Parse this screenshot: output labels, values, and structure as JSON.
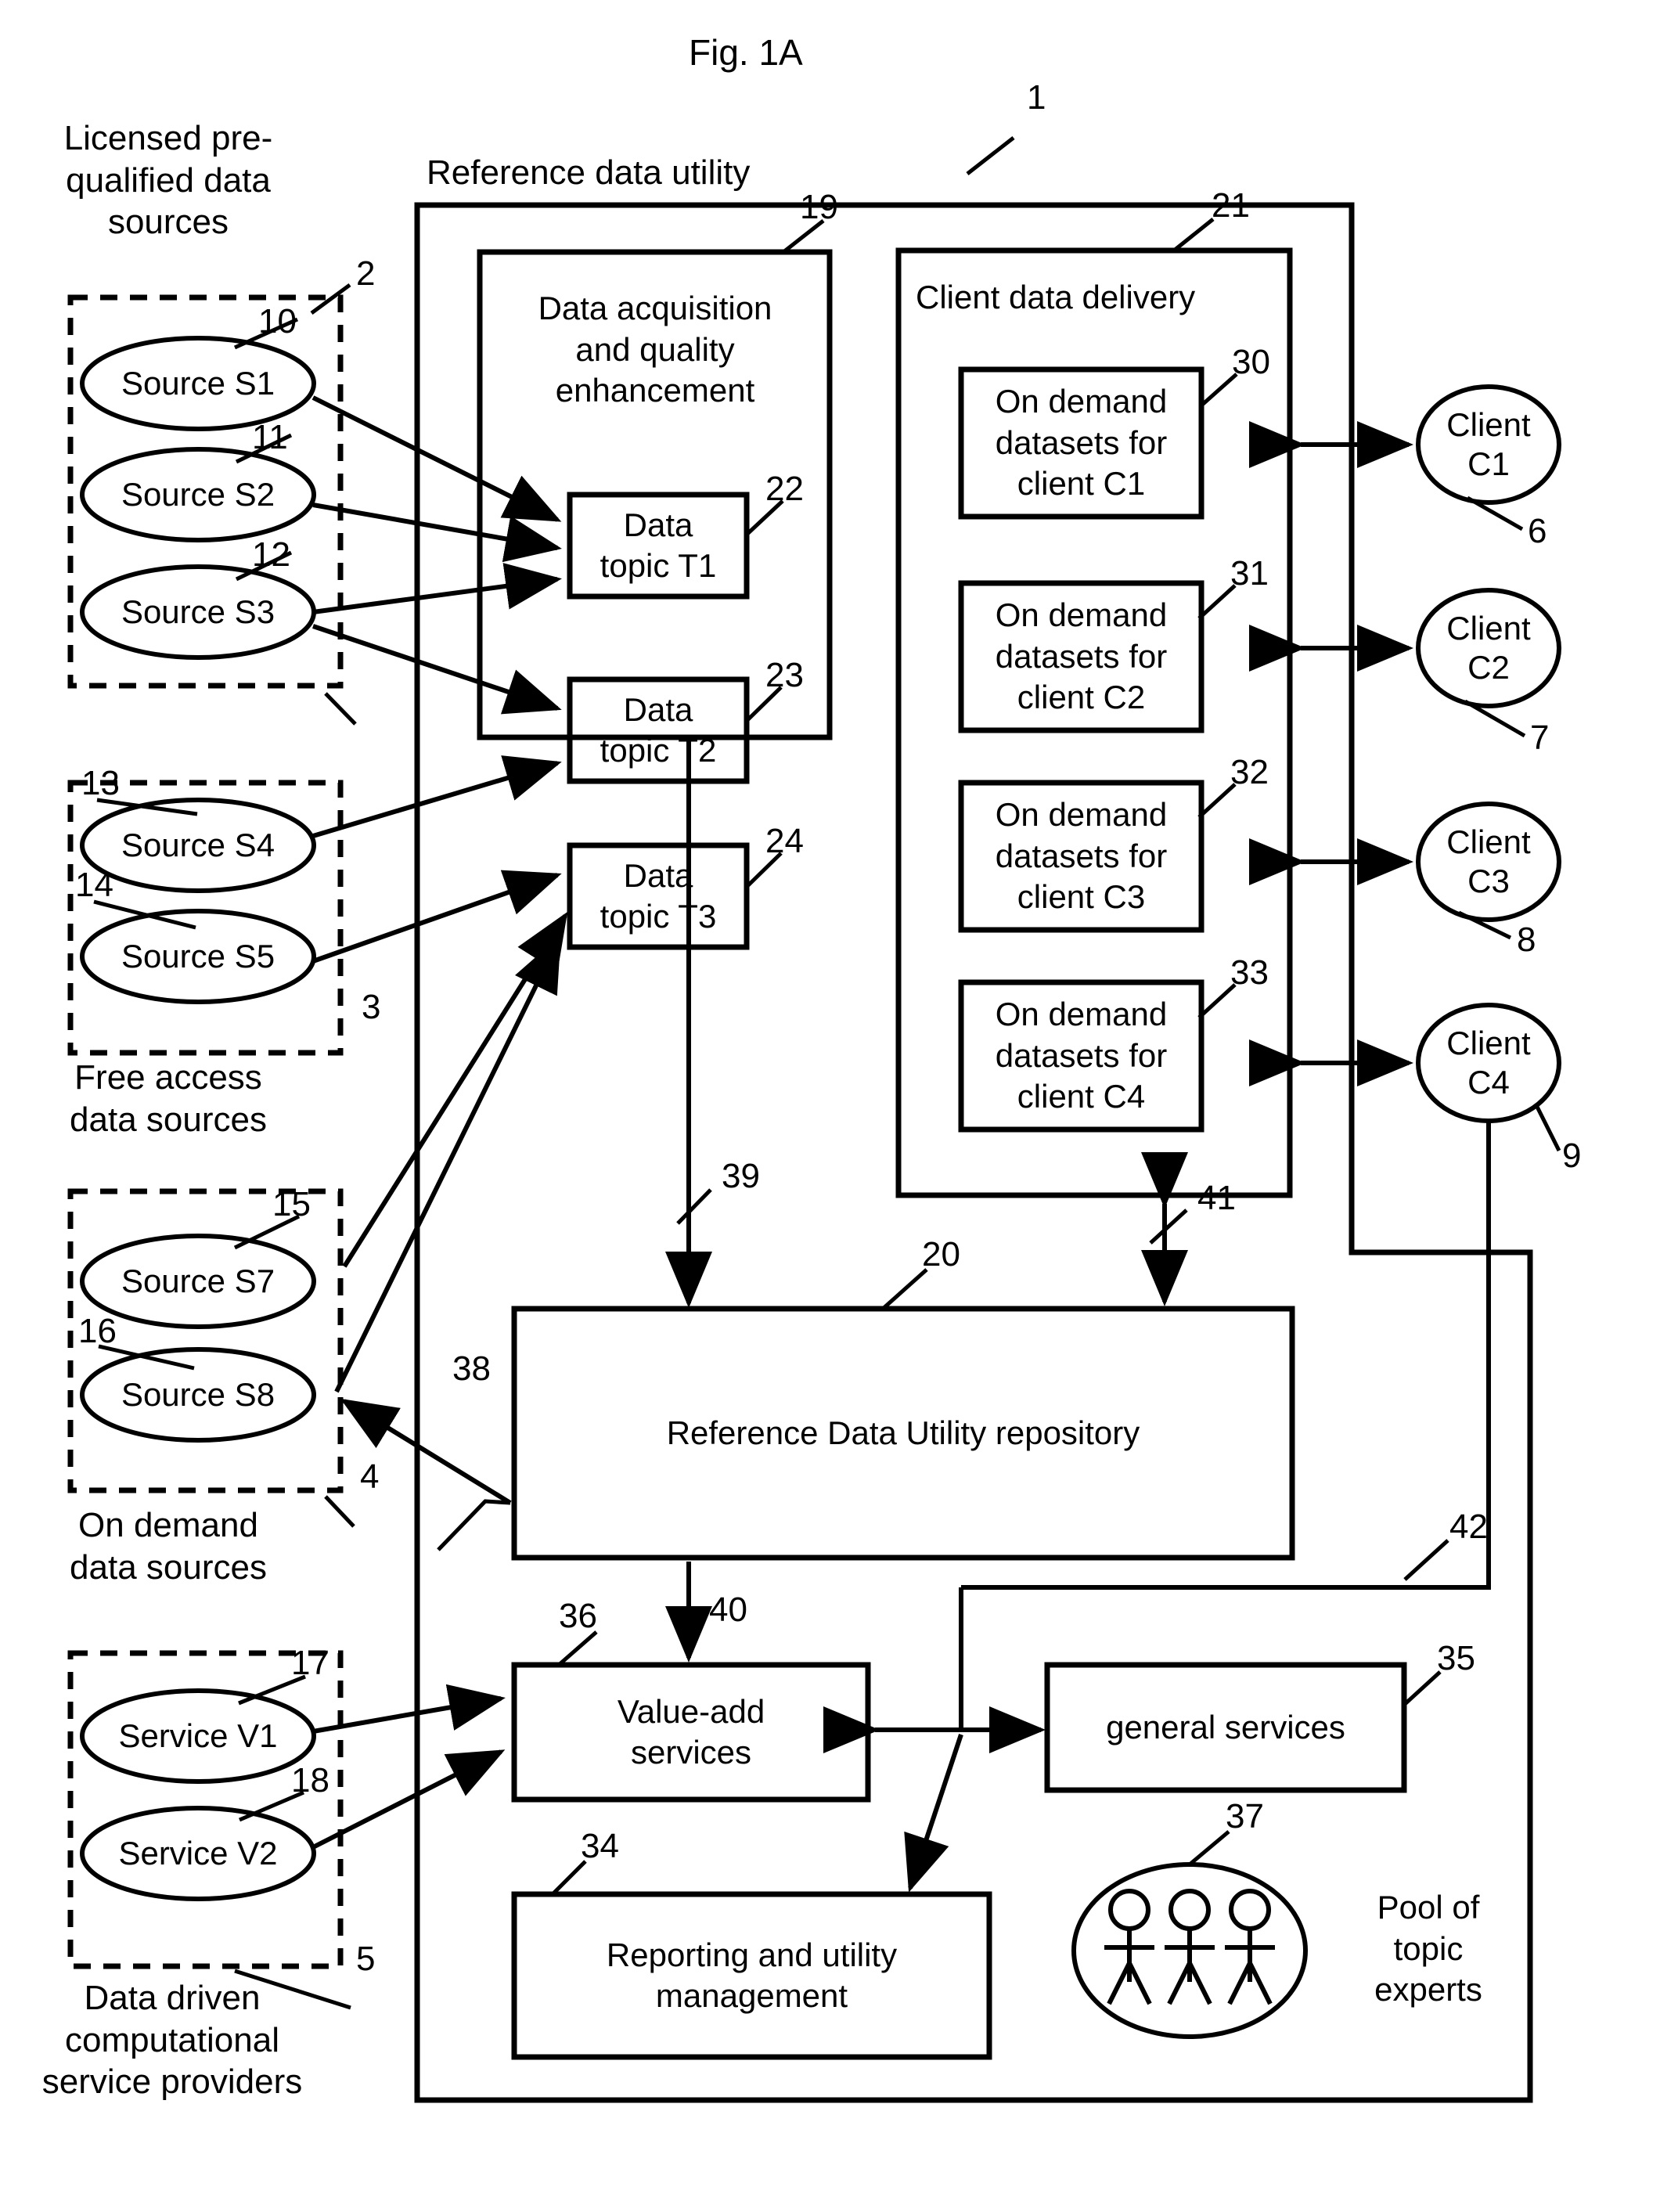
{
  "figure": {
    "title": "Fig. 1A"
  },
  "diagram": {
    "main_title": "Reference data utility",
    "main_ref": "1",
    "group_captions": {
      "licensed": "Licensed pre-\nqualified  data\nsources",
      "free": "Free access\ndata sources",
      "on_demand": "On demand\ndata sources",
      "providers": "Data driven\ncomputational\nservice providers"
    },
    "group_refs": {
      "licensed": "2",
      "free": "3",
      "on_demand": "4",
      "providers": "5"
    },
    "sources": [
      {
        "label": "Source S1",
        "ref": "10"
      },
      {
        "label": "Source S2",
        "ref": "11"
      },
      {
        "label": "Source S3",
        "ref": "12"
      },
      {
        "label": "Source S4",
        "ref": "13"
      },
      {
        "label": "Source S5",
        "ref": "14"
      },
      {
        "label": "Source S7",
        "ref": "15"
      },
      {
        "label": "Source S8",
        "ref": "16"
      }
    ],
    "services": [
      {
        "label": "Service V1",
        "ref": "17"
      },
      {
        "label": "Service V2",
        "ref": "18"
      }
    ],
    "acquisition": {
      "title": "Data acquisition\nand quality\nenhancement",
      "ref": "19",
      "topics": [
        {
          "label": "Data\ntopic T1",
          "ref": "22"
        },
        {
          "label": "Data\ntopic T2",
          "ref": "23"
        },
        {
          "label": "Data\ntopic T3",
          "ref": "24"
        }
      ]
    },
    "delivery": {
      "title": "Client data delivery",
      "ref": "21",
      "datasets": [
        {
          "label": "On demand\ndatasets for\nclient C1",
          "ref": "30"
        },
        {
          "label": "On demand\ndatasets for\nclient C2",
          "ref": "31"
        },
        {
          "label": "On demand\ndatasets for\nclient C3",
          "ref": "32"
        },
        {
          "label": "On demand\ndatasets for\nclient C4",
          "ref": "33"
        }
      ]
    },
    "clients": [
      {
        "label": "Client\nC1",
        "ref": "6"
      },
      {
        "label": "Client\nC2",
        "ref": "7"
      },
      {
        "label": "Client\nC3",
        "ref": "8"
      },
      {
        "label": "Client\nC4",
        "ref": "9"
      }
    ],
    "repository": {
      "label": "Reference Data Utility repository",
      "ref": "20"
    },
    "value_add": {
      "label": "Value-add\nservices",
      "ref": "36"
    },
    "general_services": {
      "label": "general services",
      "ref": "35"
    },
    "reporting": {
      "label": "Reporting and utility\nmanagement",
      "ref": "34"
    },
    "experts": {
      "label": "Pool of\ntopic\nexperts",
      "ref": "37"
    },
    "flow_refs": {
      "f38": "38",
      "f39": "39",
      "f40": "40",
      "f41": "41",
      "f42": "42"
    }
  },
  "colors": {
    "ink": "#000000",
    "paper": "#ffffff"
  }
}
